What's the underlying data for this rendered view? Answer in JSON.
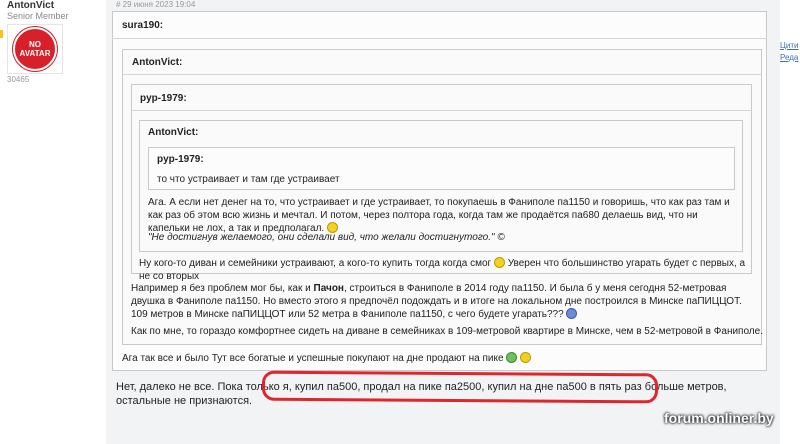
{
  "user": {
    "name": "AntonVict",
    "role": "Senior Member",
    "avatar_line1": "NO",
    "avatar_line2": "AVATAR",
    "count": "30465"
  },
  "post": {
    "date": "# 29 июня 2023 19:04"
  },
  "quotes": {
    "q1_author": "sura190:",
    "q2_author": "AntonVict:",
    "q3_author": "pyp-1979:",
    "q4_author": "AntonVict:",
    "q5_author": "pyp-1979:",
    "q5_text": "то что устраивает и там где устраивает",
    "q4_text": "Ага. А если нет денег на то, что устраивает и где устраивает, то покупаешь в Фаниполе па1150 и говоришь, что как раз там и как раз об этом всю жизнь и мечтал. И потом, через полтора года, когда там же продаётся па680 делаешь вид, что ни капельки не лох, а так и предполагал.",
    "q4_italic": "\"Не достигнув желаемого, они сделали вид, что желали достигнутого.\" ©",
    "q3_text": "Ну кого-то диван и семейники устраивают, а кого-то купить тогда когда смог",
    "q3_text2": "Уверен что большинство угарать будет с первых, а не со вторых",
    "q2_text_pre": "Например я без проблем мог бы, как и ",
    "q2_text_bold": "Пачон",
    "q2_text_post": ", строиться в Фаниполе в 2014 году па1150. И была б у меня сегодня 52-метровая двушка в Фаниполе па1150. Но вместо этого я предпочёл подождать и в итоге на локальном дне построился в Минске паПИЦЦОТ.",
    "q2_text3": "109 метров в Минске паПИЦЦОТ или 52 метра в Фаниполе па1150, с чего будете угарать???",
    "q2_text4": "Как по мне, то гораздо комфортнее сидеть на диване в семейниках в 109-метровой квартире в Минске, чем в 52-метровой в Фаниполе.",
    "q1_text": "Ага так все и было Тут все богатые и успешные покупают на дне продают на пике"
  },
  "reply": {
    "text": "Нет, далеко не все. Пока только я, купил па500, продал на пике па2500, купил на дне па500 в пять раз больше метров, остальные не признаются."
  },
  "right_links": {
    "cite": "Цити",
    "edit": "Реда"
  },
  "watermark": "forum.onliner.by",
  "colors": {
    "accent_red": "#e0262c",
    "link_blue": "#3b6fb6",
    "avatar_red": "#d7202a"
  }
}
